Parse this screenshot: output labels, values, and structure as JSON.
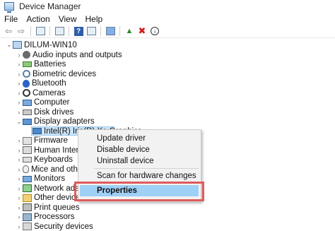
{
  "window": {
    "title": "Device Manager"
  },
  "menubar": {
    "items": [
      "File",
      "Action",
      "View",
      "Help"
    ]
  },
  "toolbar": {
    "buttons": [
      "back-arrow-icon",
      "forward-arrow-icon",
      "properties-icon",
      "show-hidden-icon",
      "help-icon",
      "view-icon",
      "update-driver-icon",
      "uninstall-icon",
      "download-icon"
    ]
  },
  "tree": {
    "root": "DILUM-WIN10",
    "categories": [
      "Audio inputs and outputs",
      "Batteries",
      "Biometric devices",
      "Bluetooth",
      "Cameras",
      "Computer",
      "Disk drives",
      "Display adapters",
      "Firmware",
      "Human Interface",
      "Keyboards",
      "Mice and other p",
      "Monitors",
      "Network adapte",
      "Other devices",
      "Print queues",
      "Processors",
      "Security devices"
    ],
    "selected_device": "Intel(R) Iris(R) Xe Graphics"
  },
  "context_menu": {
    "items": [
      "Update driver",
      "Disable device",
      "Uninstall device",
      "Scan for hardware changes",
      "Properties"
    ],
    "highlighted": "Properties"
  },
  "colors": {
    "selection": "#cce4f7",
    "menu_highlight": "#9fd0f6",
    "annotation_box": "#e05b5b"
  }
}
